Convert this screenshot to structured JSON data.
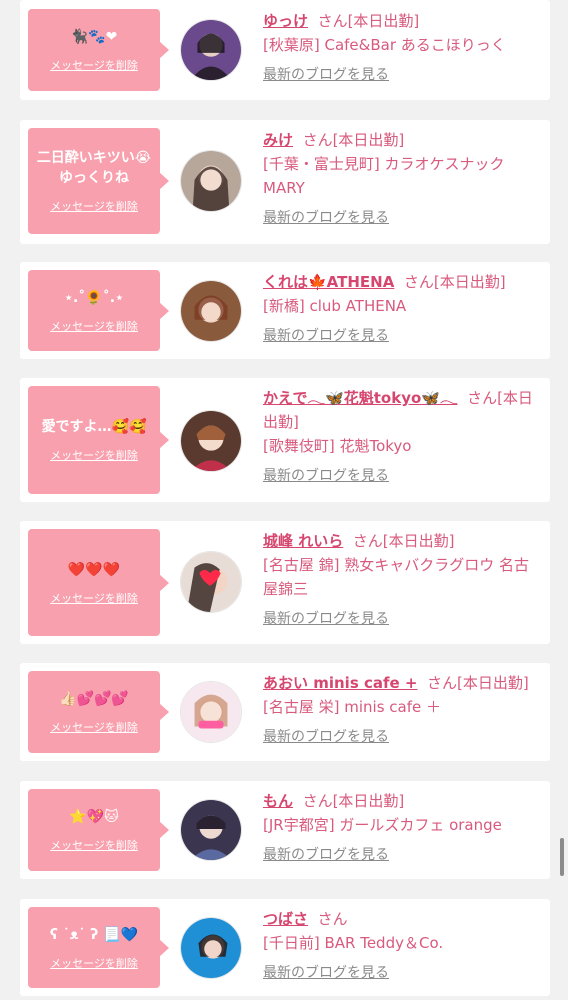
{
  "delete_label": "メッセージを削除",
  "blog_label": "最新のブログを見る",
  "colors": {
    "accent": "#d6476f",
    "bubble": "#f8a0ad",
    "link_gray": "#8a8a8a"
  },
  "cards": [
    {
      "message": "🐈‍⬛🐾❤",
      "name": "ゆっけ",
      "status": "さん[本日出勤]",
      "shop": "[秋葉原] Cafe&Bar あるこほりっく"
    },
    {
      "message": "二日酔いキツい😭 ゆっくりね",
      "name": "みけ",
      "status": "さん[本日出勤]",
      "shop": "[千葉・富士見町] カラオケスナック MARY"
    },
    {
      "message": "⋆.˚🌻˚.⋆",
      "name": "くれは🍁ATHENA",
      "status": "さん[本日出勤]",
      "shop": "[新橋] club ATHENA"
    },
    {
      "message": "愛ですよ…🥰🥰",
      "name": "かえで𓂃🦋花魁tokyo🦋𓂃",
      "status": "さん[本日出勤]",
      "shop": "[歌舞伎町] 花魁Tokyo"
    },
    {
      "message": "❤️❤️❤️",
      "name": "城峰 れいら",
      "status": "さん[本日出勤]",
      "shop": "[名古屋 錦] 熟女キャバクラグロウ 名古屋錦三"
    },
    {
      "message": "👍🏻💕💕💕",
      "name": "あおい minis cafe +",
      "status": "さん[本日出勤]",
      "shop": "[名古屋 栄] minis cafe ＋"
    },
    {
      "message": "⭐️💖🐱",
      "name": "もん",
      "status": "さん[本日出勤]",
      "shop": "[JR宇都宮] ガールズカフェ orange"
    },
    {
      "message": "ʕ ˙ᴥ˙ ʔ 📃💙",
      "name": "つばさ",
      "status": "さん",
      "shop": "[千日前] BAR Teddy＆Co."
    }
  ]
}
